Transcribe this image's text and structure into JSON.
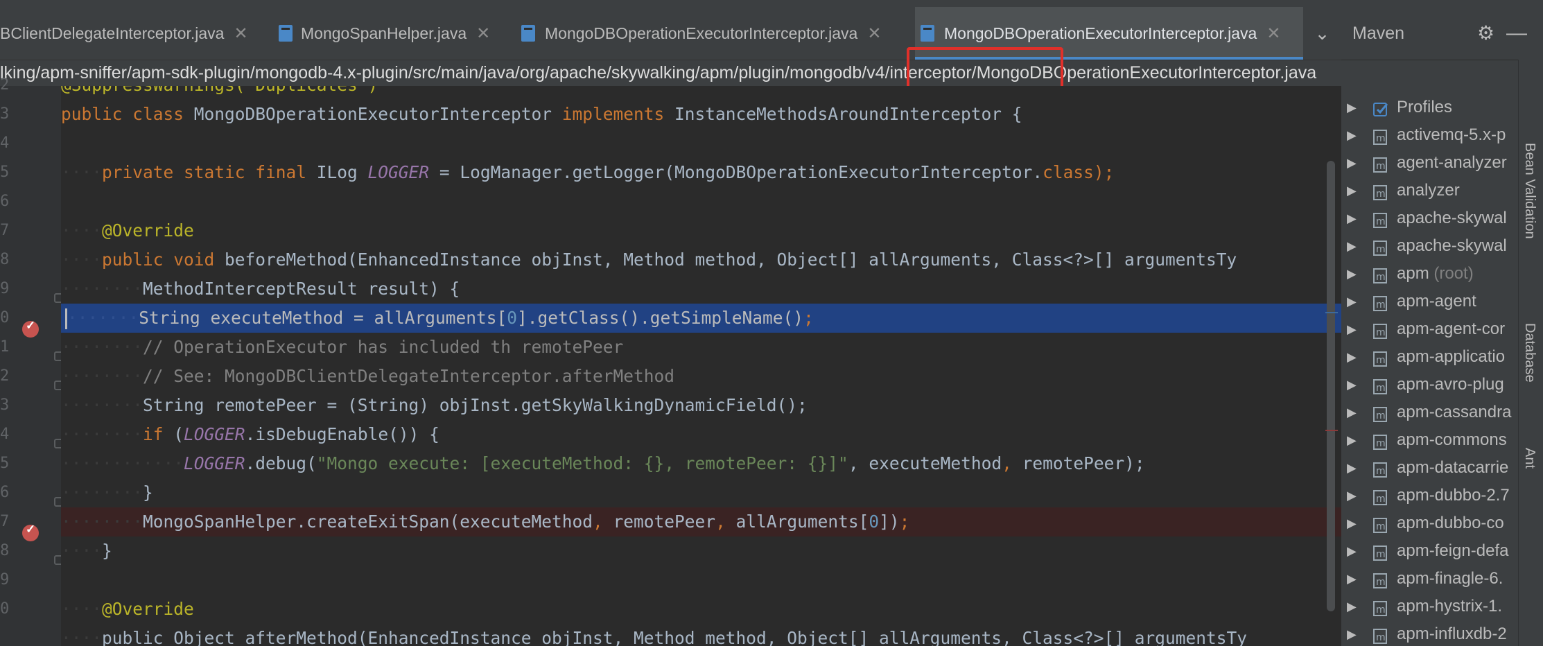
{
  "tabs": [
    {
      "label": "BClientDelegateInterceptor.java",
      "active": false
    },
    {
      "label": "MongoSpanHelper.java",
      "active": false
    },
    {
      "label": "MongoDBOperationExecutorInterceptor.java",
      "active": false
    },
    {
      "label": "MongoDBOperationExecutorInterceptor.java",
      "active": true
    }
  ],
  "breadcrumb_path": "lking/apm-sniffer/apm-sdk-plugin/mongodb-4.x-plugin/src/main/java/org/apache/skywalking/apm/plugin/mongodb/v4/interceptor/MongoDBOperationExecutorInterceptor.java",
  "maven": {
    "title": "Maven",
    "items": [
      {
        "label": "Profiles",
        "suffix": ""
      },
      {
        "label": "activemq-5.x-p",
        "suffix": ""
      },
      {
        "label": "agent-analyzer",
        "suffix": ""
      },
      {
        "label": "analyzer",
        "suffix": ""
      },
      {
        "label": "apache-skywal",
        "suffix": ""
      },
      {
        "label": "apache-skywal",
        "suffix": ""
      },
      {
        "label": "apm",
        "suffix": "(root)"
      },
      {
        "label": "apm-agent",
        "suffix": ""
      },
      {
        "label": "apm-agent-cor",
        "suffix": ""
      },
      {
        "label": "apm-applicatio",
        "suffix": ""
      },
      {
        "label": "apm-avro-plug",
        "suffix": ""
      },
      {
        "label": "apm-cassandra",
        "suffix": ""
      },
      {
        "label": "apm-commons",
        "suffix": ""
      },
      {
        "label": "apm-datacarrie",
        "suffix": ""
      },
      {
        "label": "apm-dubbo-2.7",
        "suffix": ""
      },
      {
        "label": "apm-dubbo-co",
        "suffix": ""
      },
      {
        "label": "apm-feign-defa",
        "suffix": ""
      },
      {
        "label": "apm-finagle-6.",
        "suffix": ""
      },
      {
        "label": "apm-hystrix-1.",
        "suffix": ""
      },
      {
        "label": "apm-influxdb-2",
        "suffix": ""
      }
    ]
  },
  "side_tabs": [
    "Bean Validation",
    "Database",
    "Ant"
  ],
  "line_numbers": [
    "2",
    "3",
    "4",
    "5",
    "6",
    "7",
    "8",
    "9",
    "0",
    "1",
    "2",
    "3",
    "4",
    "5",
    "6",
    "7",
    "8",
    "9",
    "0"
  ],
  "code": {
    "l2": "@SuppressWarnings(\"Duplicates\")",
    "l3": {
      "kw1": "public class",
      "name": " MongoDBOperationExecutorInterceptor ",
      "kw2": "implements",
      "iface": " InstanceMethodsAroundInterceptor {"
    },
    "l5": {
      "kw": "private static final",
      "rest": " ILog ",
      "fld": "LOGGER",
      "eq": " = LogManager.getLogger(MongoDBOperationExecutorInterceptor.",
      "cls": "class",
      "end": ");"
    },
    "l7": "@Override",
    "l8": {
      "kw": "public void",
      "rest": " beforeMethod(EnhancedInstance objInst, Method method, Object[] allArguments, Class<?>[] argumentsTy"
    },
    "l9": "MethodInterceptResult result) {",
    "l10": {
      "a": "String executeMethod = allArguments[",
      "n": "0",
      "b": "].getClass().getSimpleName()",
      "c": ";"
    },
    "l11": "// OperationExecutor has included th remotePeer",
    "l12": "// See: MongoDBClientDelegateInterceptor.afterMethod",
    "l13": "String remotePeer = (String) objInst.getSkyWalkingDynamicField();",
    "l14": {
      "kw": "if",
      "a": " (",
      "fld": "LOGGER",
      "b": ".isDebugEnable()) {"
    },
    "l15": {
      "fld": "LOGGER",
      "a": ".debug(",
      "str": "\"Mongo execute: [executeMethod: {}, remotePeer: {}]\"",
      "b": ", executeMethod",
      "c": ",",
      "d": " remotePeer);"
    },
    "l16": "}",
    "l17": {
      "a": "MongoSpanHelper.createExitSpan(executeMethod",
      "c1": ",",
      "b": " remotePeer",
      "c2": ",",
      "d": " allArguments[",
      "n": "0",
      "e": "])",
      "c3": ";"
    },
    "l18": "}",
    "l20": "@Override",
    "l21": "public Object afterMethod(EnhancedInstance objInst, Method method, Object[] allArguments, Class<?>[] argumentsTy"
  },
  "colors": {
    "background": "#2b2b2b",
    "selection": "#214283",
    "breakpoint_line": "#3a2323",
    "keyword": "#cc7832",
    "annotation": "#bbb529",
    "highlight_box": "#e0302a"
  }
}
